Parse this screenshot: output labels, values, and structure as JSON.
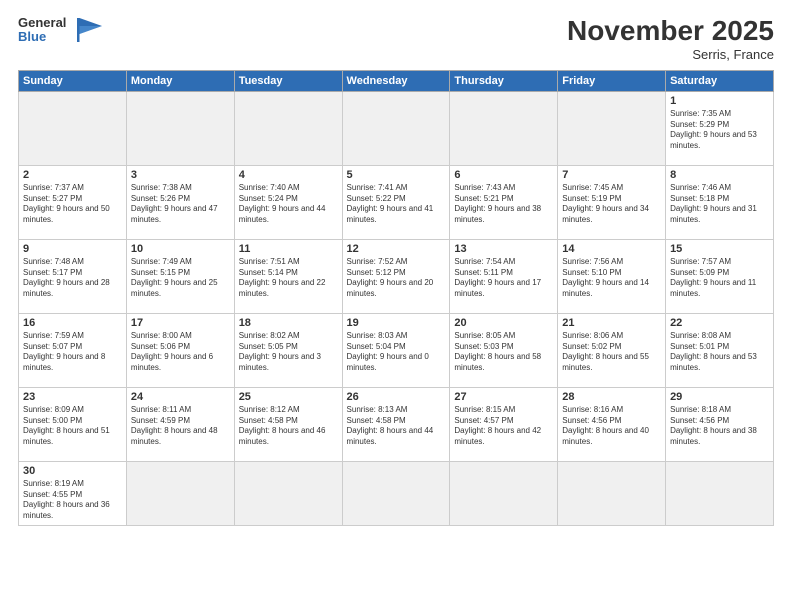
{
  "header": {
    "logo_general": "General",
    "logo_blue": "Blue",
    "month_title": "November 2025",
    "location": "Serris, France"
  },
  "days_of_week": [
    "Sunday",
    "Monday",
    "Tuesday",
    "Wednesday",
    "Thursday",
    "Friday",
    "Saturday"
  ],
  "weeks": [
    [
      {
        "day": "",
        "empty": true
      },
      {
        "day": "",
        "empty": true
      },
      {
        "day": "",
        "empty": true
      },
      {
        "day": "",
        "empty": true
      },
      {
        "day": "",
        "empty": true
      },
      {
        "day": "",
        "empty": true
      },
      {
        "day": "1",
        "sunrise": "7:35 AM",
        "sunset": "5:29 PM",
        "daylight": "9 hours and 53 minutes."
      }
    ],
    [
      {
        "day": "2",
        "sunrise": "7:37 AM",
        "sunset": "5:27 PM",
        "daylight": "9 hours and 50 minutes."
      },
      {
        "day": "3",
        "sunrise": "7:38 AM",
        "sunset": "5:26 PM",
        "daylight": "9 hours and 47 minutes."
      },
      {
        "day": "4",
        "sunrise": "7:40 AM",
        "sunset": "5:24 PM",
        "daylight": "9 hours and 44 minutes."
      },
      {
        "day": "5",
        "sunrise": "7:41 AM",
        "sunset": "5:22 PM",
        "daylight": "9 hours and 41 minutes."
      },
      {
        "day": "6",
        "sunrise": "7:43 AM",
        "sunset": "5:21 PM",
        "daylight": "9 hours and 38 minutes."
      },
      {
        "day": "7",
        "sunrise": "7:45 AM",
        "sunset": "5:19 PM",
        "daylight": "9 hours and 34 minutes."
      },
      {
        "day": "8",
        "sunrise": "7:46 AM",
        "sunset": "5:18 PM",
        "daylight": "9 hours and 31 minutes."
      }
    ],
    [
      {
        "day": "9",
        "sunrise": "7:48 AM",
        "sunset": "5:17 PM",
        "daylight": "9 hours and 28 minutes."
      },
      {
        "day": "10",
        "sunrise": "7:49 AM",
        "sunset": "5:15 PM",
        "daylight": "9 hours and 25 minutes."
      },
      {
        "day": "11",
        "sunrise": "7:51 AM",
        "sunset": "5:14 PM",
        "daylight": "9 hours and 22 minutes."
      },
      {
        "day": "12",
        "sunrise": "7:52 AM",
        "sunset": "5:12 PM",
        "daylight": "9 hours and 20 minutes."
      },
      {
        "day": "13",
        "sunrise": "7:54 AM",
        "sunset": "5:11 PM",
        "daylight": "9 hours and 17 minutes."
      },
      {
        "day": "14",
        "sunrise": "7:56 AM",
        "sunset": "5:10 PM",
        "daylight": "9 hours and 14 minutes."
      },
      {
        "day": "15",
        "sunrise": "7:57 AM",
        "sunset": "5:09 PM",
        "daylight": "9 hours and 11 minutes."
      }
    ],
    [
      {
        "day": "16",
        "sunrise": "7:59 AM",
        "sunset": "5:07 PM",
        "daylight": "9 hours and 8 minutes."
      },
      {
        "day": "17",
        "sunrise": "8:00 AM",
        "sunset": "5:06 PM",
        "daylight": "9 hours and 6 minutes."
      },
      {
        "day": "18",
        "sunrise": "8:02 AM",
        "sunset": "5:05 PM",
        "daylight": "9 hours and 3 minutes."
      },
      {
        "day": "19",
        "sunrise": "8:03 AM",
        "sunset": "5:04 PM",
        "daylight": "9 hours and 0 minutes."
      },
      {
        "day": "20",
        "sunrise": "8:05 AM",
        "sunset": "5:03 PM",
        "daylight": "8 hours and 58 minutes."
      },
      {
        "day": "21",
        "sunrise": "8:06 AM",
        "sunset": "5:02 PM",
        "daylight": "8 hours and 55 minutes."
      },
      {
        "day": "22",
        "sunrise": "8:08 AM",
        "sunset": "5:01 PM",
        "daylight": "8 hours and 53 minutes."
      }
    ],
    [
      {
        "day": "23",
        "sunrise": "8:09 AM",
        "sunset": "5:00 PM",
        "daylight": "8 hours and 51 minutes."
      },
      {
        "day": "24",
        "sunrise": "8:11 AM",
        "sunset": "4:59 PM",
        "daylight": "8 hours and 48 minutes."
      },
      {
        "day": "25",
        "sunrise": "8:12 AM",
        "sunset": "4:58 PM",
        "daylight": "8 hours and 46 minutes."
      },
      {
        "day": "26",
        "sunrise": "8:13 AM",
        "sunset": "4:58 PM",
        "daylight": "8 hours and 44 minutes."
      },
      {
        "day": "27",
        "sunrise": "8:15 AM",
        "sunset": "4:57 PM",
        "daylight": "8 hours and 42 minutes."
      },
      {
        "day": "28",
        "sunrise": "8:16 AM",
        "sunset": "4:56 PM",
        "daylight": "8 hours and 40 minutes."
      },
      {
        "day": "29",
        "sunrise": "8:18 AM",
        "sunset": "4:56 PM",
        "daylight": "8 hours and 38 minutes."
      }
    ],
    [
      {
        "day": "30",
        "sunrise": "8:19 AM",
        "sunset": "4:55 PM",
        "daylight": "8 hours and 36 minutes.",
        "last": true
      },
      {
        "day": "",
        "empty": true,
        "last": true
      },
      {
        "day": "",
        "empty": true,
        "last": true
      },
      {
        "day": "",
        "empty": true,
        "last": true
      },
      {
        "day": "",
        "empty": true,
        "last": true
      },
      {
        "day": "",
        "empty": true,
        "last": true
      },
      {
        "day": "",
        "empty": true,
        "last": true
      }
    ]
  ],
  "labels": {
    "sunrise": "Sunrise:",
    "sunset": "Sunset:",
    "daylight": "Daylight:"
  }
}
